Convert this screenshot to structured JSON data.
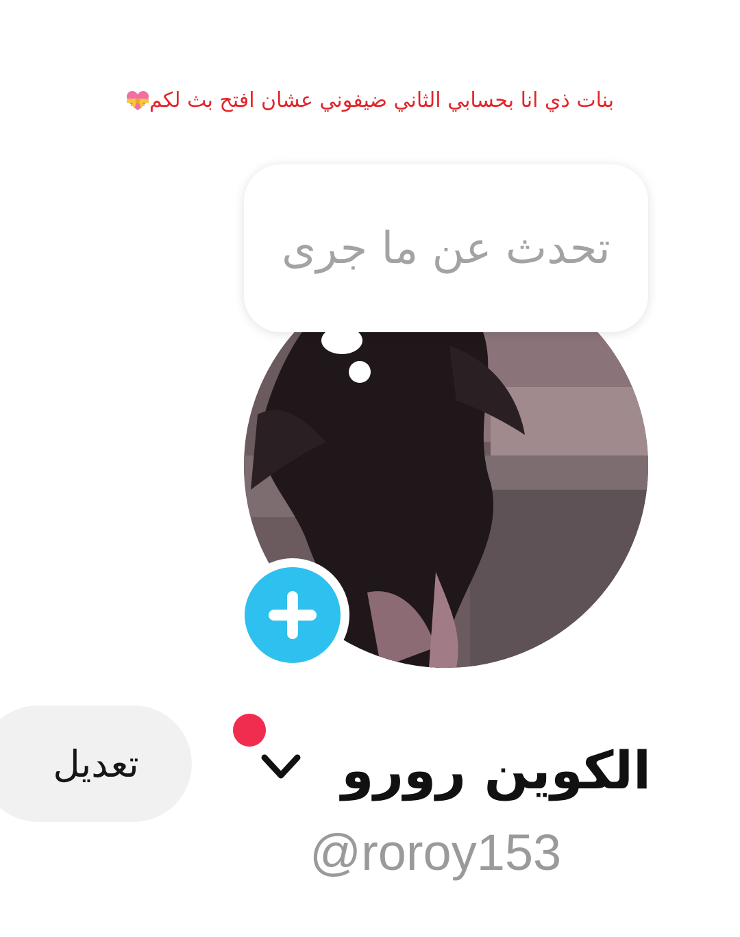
{
  "caption": {
    "text": "بنات ذي انا بحسابي الثاني ضيفوني عشان افتح بث لكم"
  },
  "thought_bubble": {
    "placeholder": "تحدث عن ما جرى"
  },
  "profile": {
    "name": "الكوين رورو",
    "username": "@roroy153",
    "edit_label": "تعديل"
  },
  "icons": {
    "caption_emoji": "heart-with-ribbon-icon",
    "add_story": "plus-icon",
    "account_switch": "chevron-down-icon",
    "notification": "red-dot-icon"
  },
  "colors": {
    "caption_text": "#e0262b",
    "add_story_button": "#2ec0ee",
    "notification_dot": "#f12d4f",
    "edit_button_bg": "#f1f1f1",
    "username_text": "#9a9a9a"
  }
}
